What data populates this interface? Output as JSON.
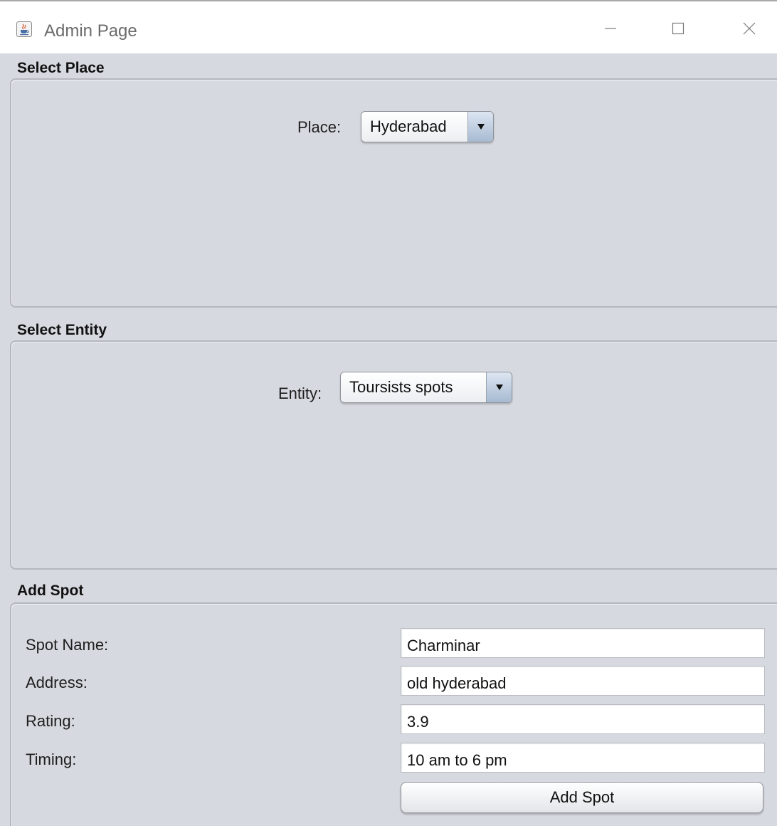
{
  "window": {
    "title": "Admin Page",
    "icon": "java-cup-icon",
    "controls": [
      "minimize-icon",
      "maximize-icon",
      "close-icon"
    ]
  },
  "select_place": {
    "section_title": "Select Place",
    "label": "Place:",
    "selected": "Hyderabad"
  },
  "select_entity": {
    "section_title": "Select Entity",
    "label": "Entity:",
    "selected": "Toursists spots"
  },
  "add_spot": {
    "section_title": "Add Spot",
    "fields": [
      {
        "label": "Spot Name:",
        "value": "Charminar"
      },
      {
        "label": "Address:",
        "value": "old hyderabad"
      },
      {
        "label": "Rating:",
        "value": "3.9"
      },
      {
        "label": "Timing:",
        "value": "10 am to 6 pm"
      }
    ],
    "button_label": "Add Spot"
  },
  "colors": {
    "background": "#d6d9df",
    "combo_arrow": "#a7bad1",
    "titlebar": "#ffffff"
  }
}
